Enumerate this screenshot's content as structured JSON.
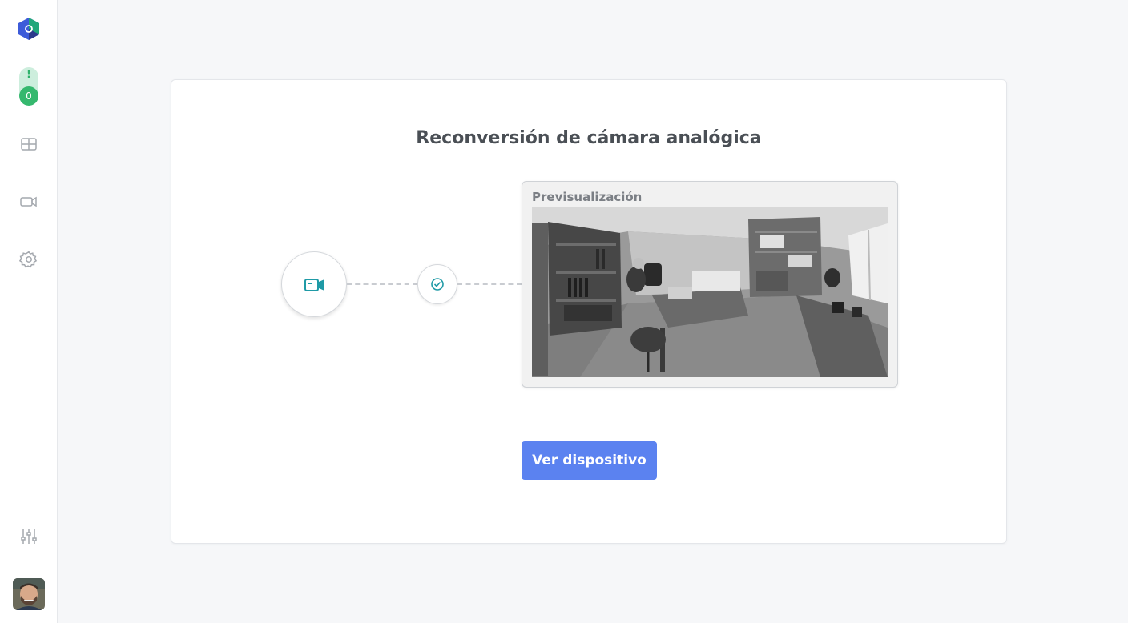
{
  "sidebar": {
    "alerts": {
      "symbol": "!",
      "count": "0"
    },
    "nav": [
      {
        "icon": "grid-layout-icon"
      },
      {
        "icon": "video-camera-icon"
      },
      {
        "icon": "gear-icon"
      },
      {
        "icon": "sliders-icon"
      }
    ]
  },
  "main": {
    "title": "Reconversión de cámara analógica",
    "preview": {
      "label": "Previsualización"
    },
    "action_button": "Ver dispositivo"
  },
  "colors": {
    "accent": "#5b82f0",
    "teal": "#1f9aa6",
    "success": "#35b86e"
  }
}
